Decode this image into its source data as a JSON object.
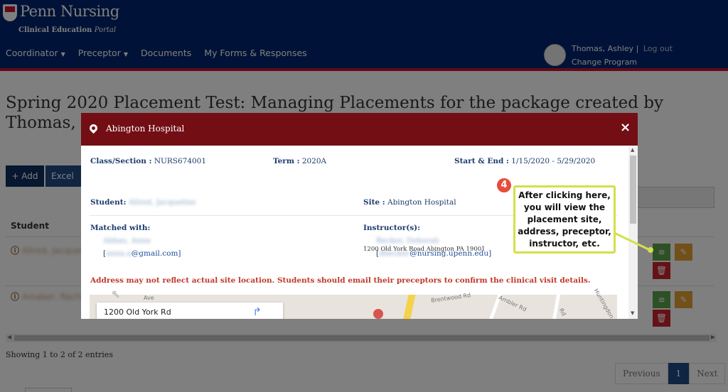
{
  "header": {
    "logo_name": "Penn Nursing",
    "logo_sub_bold": "Clinical Education",
    "logo_sub_italic": "Portal",
    "nav": [
      "Coordinator",
      "Preceptor",
      "Documents",
      "My Forms & Responses"
    ],
    "user_name": "Thomas, Ashley",
    "logout": "Log out",
    "change_program": "Change Program"
  },
  "page": {
    "title": "Spring 2020 Placement Test: Managing Placements for the package created by Thomas, Ashley on",
    "add_label": "+ Add",
    "excel_label": "Excel",
    "col_student": "Student",
    "rows": [
      {
        "name": "Allred, Jacqueline"
      },
      {
        "name": "Amaker, Rachel"
      }
    ],
    "showing": "Showing 1 to 2 of 2 entries",
    "pager": {
      "previous": "Previous",
      "page": "1",
      "next": "Next"
    }
  },
  "modal": {
    "title": "Abington Hospital",
    "close": "×",
    "class_label": "Class/Section :",
    "class_value": "NURS674001",
    "term_label": "Term :",
    "term_value": "2020A",
    "dates_label": "Start & End :",
    "dates_value": "1/15/2020 - 5/29/2020",
    "student_label": "Student:",
    "student_value": "Allred, Jacqueline",
    "site_label": "Site :",
    "site_value": "Abington Hospital",
    "site_address": "1200 Old York Road Abington PA 19001",
    "matched_label": "Matched with:",
    "matched_name": "Abbas, Anna",
    "matched_email_user": "anna.a",
    "matched_email_domain": "@gmail.com]",
    "instructor_label": "Instructor(s):",
    "instructor_name": "Becker, Deborah",
    "instructor_email_user": "dbecker",
    "instructor_email_domain": "@nursing.upenn.edu]",
    "warning": "Address may not reflect actual site location. Students should email their preceptors to confirm the clinical visit details.",
    "map_address": "1200 Old York Rd",
    "map_labels": [
      "Ave",
      "Brentwood Rd",
      "Ambler Rd",
      "Rd",
      "Huntingdon"
    ]
  },
  "callout": {
    "number": "4",
    "text": "After clicking here, you will view the placement site, address, preceptor, instructor, etc."
  },
  "colors": {
    "header_bg": "#01256e",
    "header_accent": "#c4122f",
    "modal_header": "#720e14",
    "callout_border": "#d4e04a",
    "badge": "#e74c3c",
    "warning_text": "#c0392b"
  }
}
